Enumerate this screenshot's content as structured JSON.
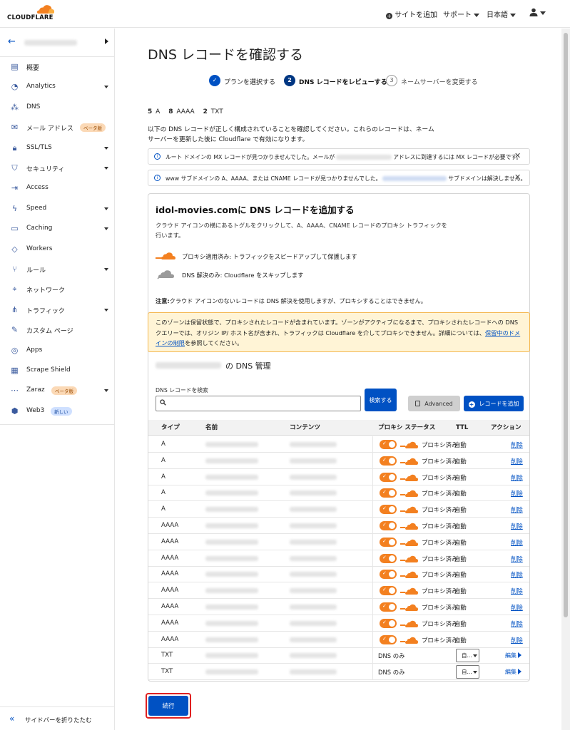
{
  "brand": {
    "name": "CLOUDFLARE",
    "orange": "#f38020",
    "blue": "#0051c3"
  },
  "topbar": {
    "add_site": "サイトを追加",
    "support": "サポート",
    "language": "日本語",
    "user_icon": "user-icon"
  },
  "sidebar": {
    "account_name_blurred": "",
    "items": [
      {
        "label": "概要",
        "icon": "document-icon",
        "dropdown": false
      },
      {
        "label": "Analytics",
        "icon": "clock-chart-icon",
        "dropdown": true
      },
      {
        "label": "DNS",
        "icon": "network-icon",
        "dropdown": false
      },
      {
        "label": "メール アドレス",
        "icon": "email-icon",
        "dropdown": false,
        "badge": "ベータ版"
      },
      {
        "label": "SSL/TLS",
        "icon": "lock-icon",
        "dropdown": true
      },
      {
        "label": "セキュリティ",
        "icon": "shield-icon",
        "dropdown": true
      },
      {
        "label": "Access",
        "icon": "access-icon",
        "dropdown": false
      },
      {
        "label": "Speed",
        "icon": "lightning-icon",
        "dropdown": true
      },
      {
        "label": "Caching",
        "icon": "server-icon",
        "dropdown": true
      },
      {
        "label": "Workers",
        "icon": "workers-icon",
        "dropdown": false
      },
      {
        "label": "ルール",
        "icon": "fork-icon",
        "dropdown": true
      },
      {
        "label": "ネットワーク",
        "icon": "location-icon",
        "dropdown": false
      },
      {
        "label": "トラフィック",
        "icon": "traffic-icon",
        "dropdown": true
      },
      {
        "label": "カスタム ページ",
        "icon": "wrench-icon",
        "dropdown": false
      },
      {
        "label": "Apps",
        "icon": "apps-icon",
        "dropdown": false
      },
      {
        "label": "Scrape Shield",
        "icon": "doc-shield-icon",
        "dropdown": false
      },
      {
        "label": "Zaraz",
        "icon": "zaraz-icon",
        "dropdown": true,
        "badge": "ベータ版"
      },
      {
        "label": "Web3",
        "icon": "web3-icon",
        "dropdown": false,
        "badge": "新しい"
      }
    ],
    "collapse_label": "サイドバーを折りたたむ"
  },
  "page": {
    "title": "DNS レコードを確認する",
    "steps": [
      {
        "num": "✓",
        "label": "プランを選択する",
        "state": "done"
      },
      {
        "num": "2",
        "label": "DNS レコードをレビューする",
        "state": "current"
      },
      {
        "num": "3",
        "label": "ネームサーバーを変更する",
        "state": "todo"
      }
    ],
    "counts": [
      {
        "n": "5",
        "t": "A"
      },
      {
        "n": "8",
        "t": "AAAA"
      },
      {
        "n": "2",
        "t": "TXT"
      }
    ],
    "description": "以下の DNS レコードが正しく構成されていることを確認してください。これらのレコードは、ネームサーバーを更新した後に Cloudflare で有効になります。",
    "alerts": [
      {
        "pre": "ルート ドメインの MX レコードが見つかりませんでした。メールが",
        "post": "アドレスに到達するには MX レコードが必要です。"
      },
      {
        "pre": "www サブドメインの A、AAAA、または CNAME レコードが見つかりませんでした。",
        "post": "サブドメインは解決しません。"
      }
    ],
    "card": {
      "title": "idol-movies.comに DNS レコードを追加する",
      "desc": "クラウド アイコンの横にあるトグルをクリックして、A、AAAA、CNAME レコードのプロキシ トラフィックを行います。",
      "legend_proxied": "プロキシ適用済み: トラフィックをスピードアップして保護します",
      "legend_dns_only": "DNS 解決のみ: Cloudflare をスキップします",
      "note_label": "注意:",
      "note_text": "クラウド アイコンのないレコードは DNS 解決を使用しますが、プロキシすることはできません。",
      "warning_text": "このゾーンは保留状態で、プロキシされたレコードが含まれています。ゾーンがアクティブになるまで、プロキシされたレコードへの DNS クエリーでは、オリジン IP/ ホスト名が含まれ、トラフィックは Cloudflare を介してプロキシできません。詳細については、",
      "warning_link": "保留中のドメインの制限",
      "warning_tail": "を参照してください。",
      "mgmt_suffix": "の DNS 管理",
      "search_label": "DNS レコードを検索",
      "search_value": "",
      "search_button": "検索する",
      "advanced_button": "Advanced",
      "add_button": "レコードを追加"
    },
    "table": {
      "headers": [
        "タイプ",
        "名前",
        "コンテンツ",
        "プロキシ ステータス",
        "TTL",
        "アクション"
      ],
      "rows": [
        {
          "type": "A",
          "proxied": true,
          "status": "プロキシ済み",
          "ttl": "自動",
          "action": "削除"
        },
        {
          "type": "A",
          "proxied": true,
          "status": "プロキシ済み",
          "ttl": "自動",
          "action": "削除"
        },
        {
          "type": "A",
          "proxied": true,
          "status": "プロキシ済み",
          "ttl": "自動",
          "action": "削除"
        },
        {
          "type": "A",
          "proxied": true,
          "status": "プロキシ済み",
          "ttl": "自動",
          "action": "削除"
        },
        {
          "type": "A",
          "proxied": true,
          "status": "プロキシ済み",
          "ttl": "自動",
          "action": "削除"
        },
        {
          "type": "AAAA",
          "proxied": true,
          "status": "プロキシ済み",
          "ttl": "自動",
          "action": "削除"
        },
        {
          "type": "AAAA",
          "proxied": true,
          "status": "プロキシ済み",
          "ttl": "自動",
          "action": "削除"
        },
        {
          "type": "AAAA",
          "proxied": true,
          "status": "プロキシ済み",
          "ttl": "自動",
          "action": "削除"
        },
        {
          "type": "AAAA",
          "proxied": true,
          "status": "プロキシ済み",
          "ttl": "自動",
          "action": "削除"
        },
        {
          "type": "AAAA",
          "proxied": true,
          "status": "プロキシ済み",
          "ttl": "自動",
          "action": "削除"
        },
        {
          "type": "AAAA",
          "proxied": true,
          "status": "プロキシ済み",
          "ttl": "自動",
          "action": "削除"
        },
        {
          "type": "AAAA",
          "proxied": true,
          "status": "プロキシ済み",
          "ttl": "自動",
          "action": "削除"
        },
        {
          "type": "AAAA",
          "proxied": true,
          "status": "プロキシ済み",
          "ttl": "自動",
          "action": "削除"
        },
        {
          "type": "TXT",
          "proxied": false,
          "status": "DNS のみ",
          "ttl": "自...",
          "action": "編集"
        },
        {
          "type": "TXT",
          "proxied": false,
          "status": "DNS のみ",
          "ttl": "自...",
          "action": "編集"
        }
      ]
    },
    "continue_button": "続行"
  }
}
